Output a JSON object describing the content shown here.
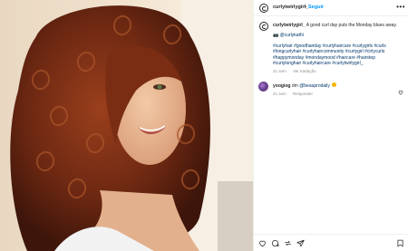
{
  "post": {
    "username": "curlytwirlygirl_",
    "follow_label": "Seguir",
    "dot": "•",
    "more": "•••",
    "caption_user": "curlytwirlygirl_",
    "caption_text": "A good curl day puts the Monday blues away.",
    "credit_emoji": "📷",
    "credit_mention": "@curlykathi",
    "hashtags": "#curlyhair #goodhairday #curlyhaircare #curlygirls #curls #longcurlyhair #curlyhaircommunity #curlygirl #cirlycurls #happymonday #mondaymood #haircare #hairstep #curlylonghair #curlyhaircare #curlytwirlygirl_",
    "caption_time": "21 sem",
    "see_translation": "Ver tradução",
    "comment_user": "yoogiog",
    "comment_text_pre": "dm",
    "comment_mention": "@beauprodaily",
    "comment_time": "21 sem",
    "reply_label": "Responder"
  },
  "icons": {
    "profile": "threads-logo-icon",
    "more": "more-dots-icon",
    "like_small": "heart-outline-icon",
    "like": "heart-icon",
    "comment": "comment-icon",
    "share": "share-icon",
    "save": "bookmark-icon"
  },
  "colors": {
    "link": "#00376b",
    "follow": "#0095f6",
    "muted": "#8e8e8e",
    "text": "#262626"
  }
}
